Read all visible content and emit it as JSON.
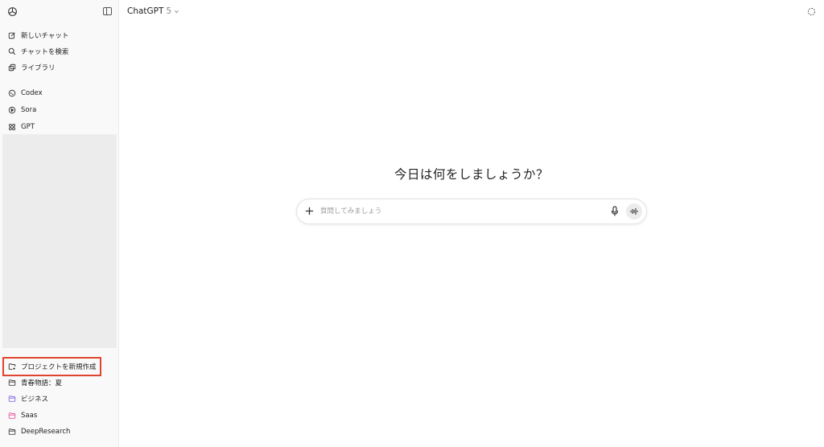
{
  "header": {
    "model_name": "ChatGPT",
    "model_version": "5"
  },
  "sidebar": {
    "top_items": [
      {
        "label": "新しいチャット",
        "icon": "compose-icon"
      },
      {
        "label": "チャットを検索",
        "icon": "search-icon"
      },
      {
        "label": "ライブラリ",
        "icon": "library-icon"
      }
    ],
    "apps": [
      {
        "label": "Codex",
        "icon": "codex-icon"
      },
      {
        "label": "Sora",
        "icon": "sora-icon"
      },
      {
        "label": "GPT",
        "icon": "gpt-grid-icon"
      }
    ],
    "projects": [
      {
        "label": "プロジェクトを新規作成",
        "icon": "new-folder-icon",
        "color": "#444444"
      },
      {
        "label": "青春物語：夏",
        "icon": "folder-icon",
        "color": "#444444"
      },
      {
        "label": "ビジネス",
        "icon": "folder-icon",
        "color": "#8b6fe8"
      },
      {
        "label": "Saas",
        "icon": "folder-icon",
        "color": "#e85aa0"
      },
      {
        "label": "DeepResearch",
        "icon": "folder-icon",
        "color": "#444444"
      }
    ]
  },
  "main": {
    "headline": "今日は何をしましょうか？",
    "composer_placeholder": "質問してみましょう"
  },
  "colors": {
    "highlight": "#e0442e",
    "sidebar_bg": "#f9f9f9"
  }
}
